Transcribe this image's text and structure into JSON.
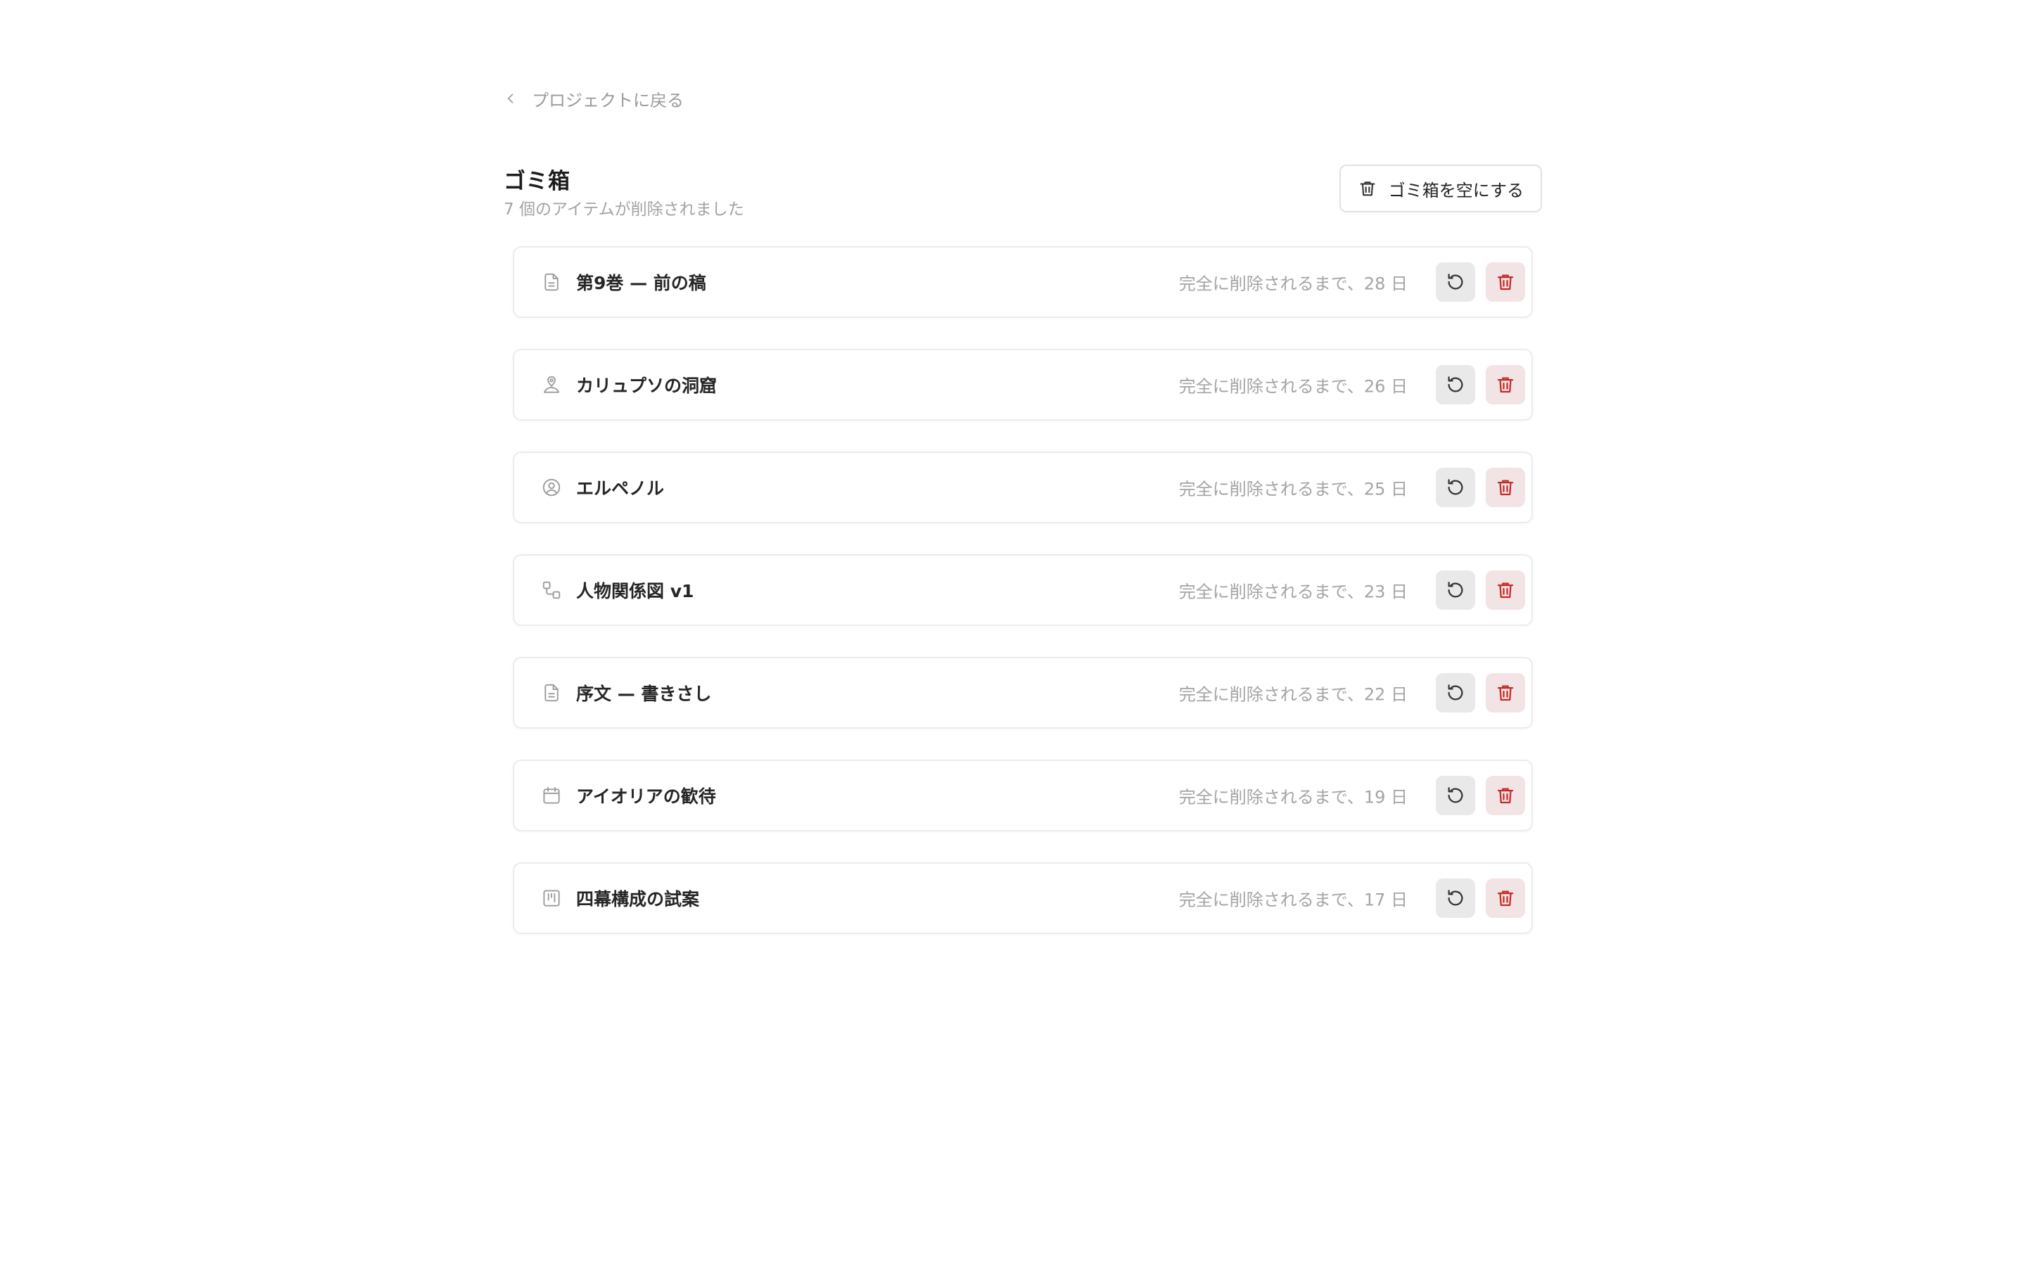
{
  "nav": {
    "back_label": "プロジェクトに戻る"
  },
  "header": {
    "title": "ゴミ箱",
    "subtitle": "7 個のアイテムが削除されました",
    "empty_button_label": "ゴミ箱を空にする"
  },
  "items": [
    {
      "name": "第9巻 — 前の稿",
      "icon": "document-icon",
      "remaining": "完全に削除されるまで、28 日"
    },
    {
      "name": "カリュプソの洞窟",
      "icon": "location-pin-icon",
      "remaining": "完全に削除されるまで、26 日"
    },
    {
      "name": "エルペノル",
      "icon": "user-circle-icon",
      "remaining": "完全に削除されるまで、25 日"
    },
    {
      "name": "人物関係図 v1",
      "icon": "relationship-graph-icon",
      "remaining": "完全に削除されるまで、23 日"
    },
    {
      "name": "序文 — 書きさし",
      "icon": "document-icon",
      "remaining": "完全に削除されるまで、22 日"
    },
    {
      "name": "アイオリアの歓待",
      "icon": "calendar-icon",
      "remaining": "完全に削除されるまで、19 日"
    },
    {
      "name": "四幕構成の試案",
      "icon": "kanban-board-icon",
      "remaining": "完全に削除されるまで、17 日"
    }
  ],
  "colors": {
    "delete_accent": "#c62a2a",
    "muted_text": "#a4a4a4"
  }
}
